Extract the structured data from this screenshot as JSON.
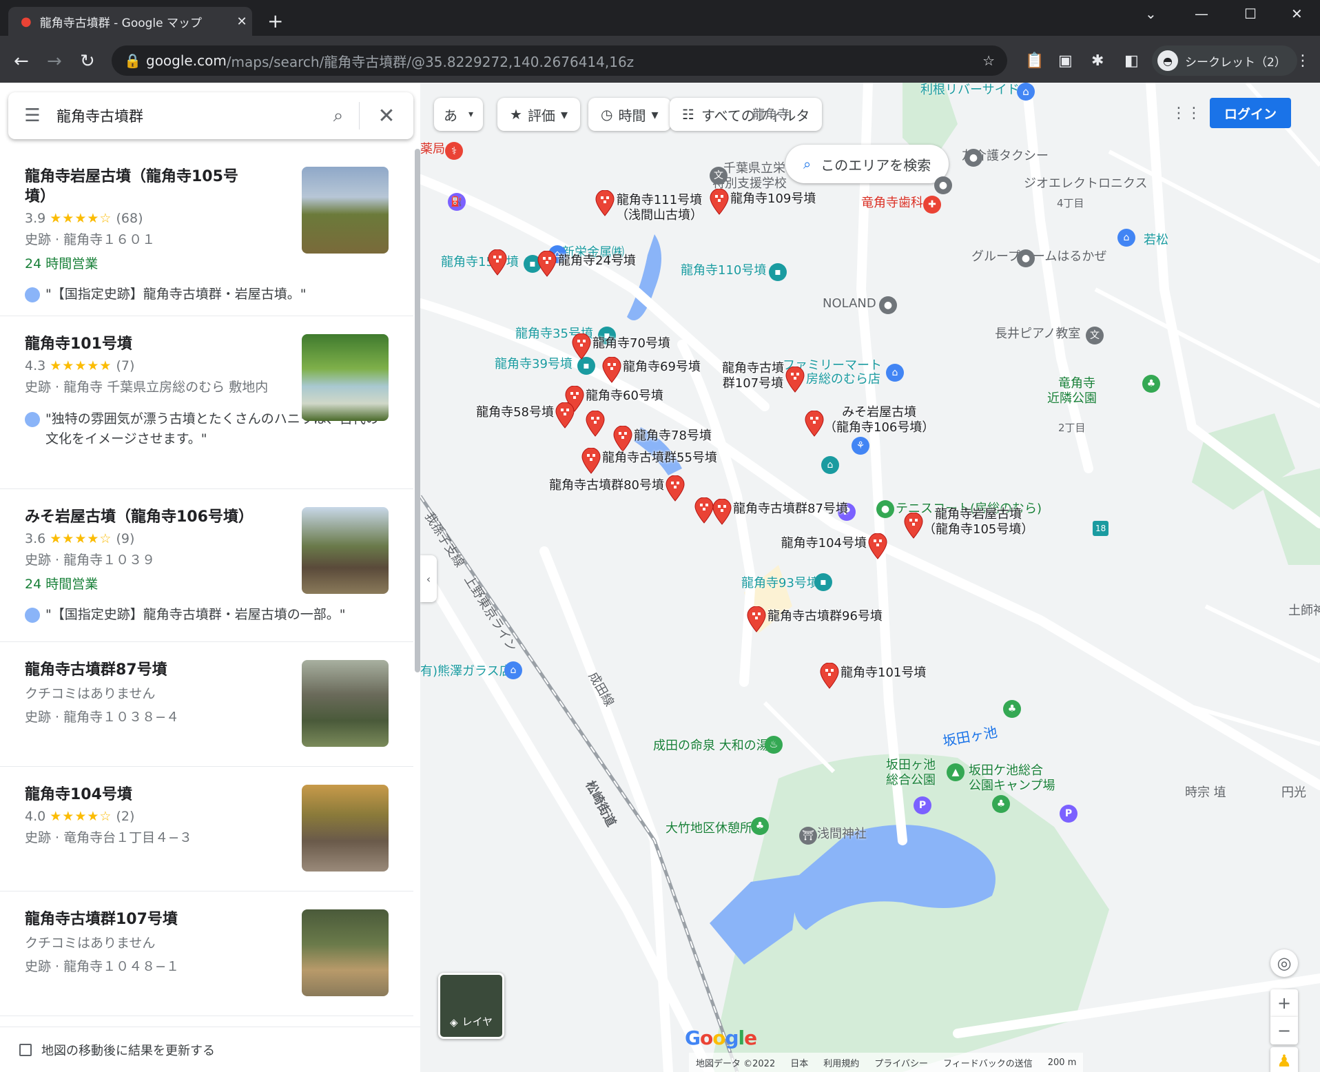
{
  "browser": {
    "tab_title": "龍角寺古墳群 - Google マップ",
    "url_host": "google.com",
    "url_path": "/maps/search/龍角寺古墳群/@35.8229272,140.2676414,16z",
    "incognito_label": "シークレット（2）"
  },
  "search": {
    "query": "龍角寺古墳群"
  },
  "results": [
    {
      "name": "龍角寺岩屋古墳（龍角寺105号墳）",
      "rating": "3.9",
      "stars": "★★★★☆",
      "count": "(68)",
      "line": "史跡 · 龍角寺１６０１",
      "open": "24 時間営業",
      "review": "\"【国指定史跡】龍角寺古墳群・岩屋古墳。\""
    },
    {
      "name": "龍角寺101号墳",
      "rating": "4.3",
      "stars": "★★★★★",
      "count": "(7)",
      "line": "史跡 · 龍角寺 千葉県立房総のむら 敷地内",
      "open": "",
      "review": "\"独特の雰囲気が漂う古墳とたくさんのハニワは、古代の文化をイメージさせます。\""
    },
    {
      "name": "みそ岩屋古墳（龍角寺106号墳）",
      "rating": "3.6",
      "stars": "★★★★☆",
      "count": "(9)",
      "line": "史跡 · 龍角寺１０３９",
      "open": "24 時間営業",
      "review": "\"【国指定史跡】龍角寺古墳群・岩屋古墳の一部。\""
    },
    {
      "name": "龍角寺古墳群87号墳",
      "rating": "",
      "stars": "",
      "count": "",
      "no_reviews": "クチコミはありません",
      "line": "史跡 · 龍角寺１０３８−４",
      "open": "",
      "review": ""
    },
    {
      "name": "龍角寺104号墳",
      "rating": "4.0",
      "stars": "★★★★☆",
      "count": "(2)",
      "line": "史跡 · 竜角寺台１丁目４−３",
      "open": "",
      "review": ""
    },
    {
      "name": "龍角寺古墳群107号墳",
      "rating": "",
      "stars": "",
      "count": "",
      "no_reviews": "クチコミはありません",
      "line": "史跡 · 龍角寺１０４８−１",
      "open": "",
      "review": ""
    }
  ],
  "footer": {
    "update_label": "地図の移動後に結果を更新する"
  },
  "map": {
    "ime": "あ",
    "chips": [
      "評価",
      "時間",
      "すべてのフィルタ"
    ],
    "search_area": "このエリアを検索",
    "login": "ログイン",
    "layer": "レイヤ",
    "credits": [
      "地図データ ©2022",
      "日本",
      "利用規約",
      "プライバシー",
      "フィードバックの送信",
      "200 m"
    ],
    "labels": {
      "ryukakuji_top": "龍角寺",
      "yakkyoku": "薬局",
      "tone": "利根リバーサイド",
      "tomo": "友介護タクシー",
      "school1": "千葉県立栄",
      "school2": "特別支援学校",
      "dental": "竜角寺歯科",
      "geo": "ジオエレクトロニクス",
      "chome4": "4丁目",
      "waka": "若松",
      "group": "グループホームはるかぜ",
      "shinei": "新栄金属㈱",
      "p15": "龍角寺15号墳",
      "p110": "龍角寺110号墳",
      "noland": "NOLAND",
      "p35": "龍角寺35号墳",
      "nagai": "長井ピアノ教室",
      "p39": "龍角寺39号墳",
      "fm1": "ファミリーマート",
      "fm2": "房総のむら店",
      "park1": "竜角寺",
      "park2": "近隣公園",
      "chome2": "2丁目",
      "tennis": "テニスコート(房総のむら)",
      "p93": "龍角寺93号墳",
      "glass": "有)熊澤ガラス店",
      "onsen": "成田の命泉 大和の湯",
      "pond": "坂田ヶ池",
      "sakata1": "坂田ヶ池",
      "sakata2": "総合公園",
      "camp1": "坂田ケ池総合",
      "camp2": "公園キャンプ場",
      "rest": "大竹地区休憩所",
      "shrine": "浅間神社",
      "jisou": "時宗 埴",
      "enzu": "円光",
      "tsuchi": "土師神",
      "rail1": "我孫子支線　上野東京ライン",
      "rail2": "成田線",
      "road": "松崎街道",
      "route18": "18"
    },
    "pins": [
      {
        "label": "龍角寺111号墳\n（浅間山古墳）"
      },
      {
        "label": "龍角寺109号墳"
      },
      {
        "label": ""
      },
      {
        "label": "龍角寺24号墳"
      },
      {
        "label": "龍角寺70号墳"
      },
      {
        "label": "龍角寺69号墳"
      },
      {
        "label": "龍角寺古墳\n群107号墳"
      },
      {
        "label": "龍角寺60号墳"
      },
      {
        "label": "龍角寺58号墳"
      },
      {
        "label": ""
      },
      {
        "label": "龍角寺78号墳"
      },
      {
        "label": "みそ岩屋古墳\n（龍角寺106号墳）"
      },
      {
        "label": "龍角寺古墳群55号墳"
      },
      {
        "label": "龍角寺古墳群80号墳"
      },
      {
        "label": ""
      },
      {
        "label": "龍角寺古墳群87号墳"
      },
      {
        "label": "龍角寺岩屋古墳\n（龍角寺105号墳）"
      },
      {
        "label": "龍角寺104号墳"
      },
      {
        "label": "龍角寺古墳群96号墳"
      },
      {
        "label": "龍角寺101号墳"
      }
    ]
  },
  "colors": {
    "pin": "#ea4335",
    "accent": "#1a73e8",
    "park": "#d4ecd8",
    "water": "#8ab4f8"
  }
}
